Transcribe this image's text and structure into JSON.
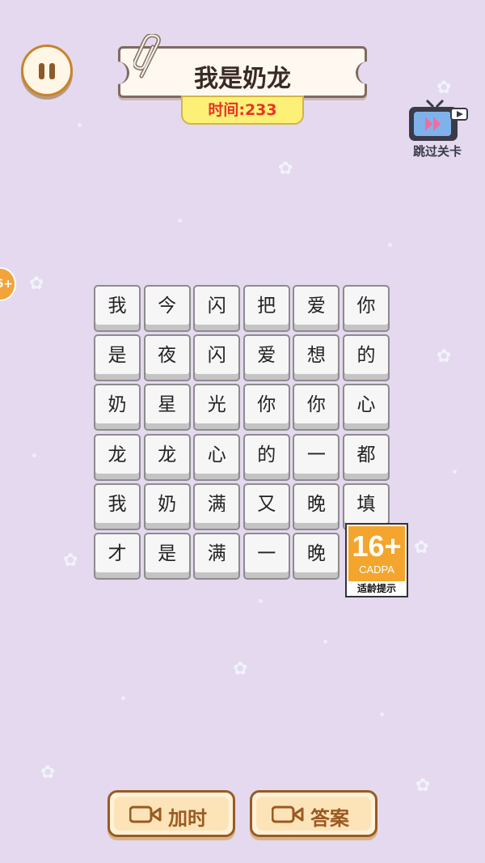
{
  "level": {
    "title": "我是奶龙"
  },
  "timer": {
    "text": "时间:233"
  },
  "skip": {
    "label": "跳过关卡"
  },
  "side_badge": {
    "text": "6+"
  },
  "grid": {
    "rows": [
      [
        "我",
        "今",
        "闪",
        "把",
        "爱",
        "你"
      ],
      [
        "是",
        "夜",
        "闪",
        "爱",
        "想",
        "的"
      ],
      [
        "奶",
        "星",
        "光",
        "你",
        "你",
        "心"
      ],
      [
        "龙",
        "龙",
        "心",
        "的",
        "一",
        "都"
      ],
      [
        "我",
        "奶",
        "满",
        "又",
        "晚",
        "填"
      ],
      [
        "才",
        "是",
        "满",
        "一",
        "晚",
        ""
      ]
    ]
  },
  "age_rating": {
    "number": "16+",
    "org": "CADPA",
    "caption": "适龄提示"
  },
  "buttons": {
    "add_time": "加时",
    "answer": "答案"
  },
  "colors": {
    "background": "#e4d9ef",
    "timer_text": "#e53628",
    "button_text": "#9a5a23",
    "rating_orange": "#f3a52d"
  }
}
